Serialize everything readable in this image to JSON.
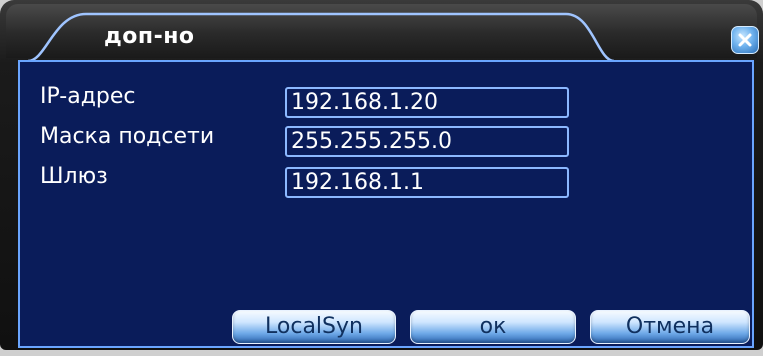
{
  "dialog": {
    "title": "доп-но",
    "close_icon": "close-icon"
  },
  "fields": [
    {
      "label": "IP-адрес",
      "value": "192.168.1.20"
    },
    {
      "label": "Маска подсети",
      "value": "255.255.255.0"
    },
    {
      "label": "Шлюз",
      "value": "192.168.1.1"
    }
  ],
  "buttons": {
    "localsyn": "LocalSyn",
    "ok": "ок",
    "cancel": "Отмена"
  },
  "colors": {
    "panel_background": "#0a1c5a",
    "panel_border": "#6aa5ff",
    "button_gradient_top": "#f6fbff",
    "button_gradient_bottom": "#2d66b1",
    "close_button": "#6fb2ee"
  }
}
